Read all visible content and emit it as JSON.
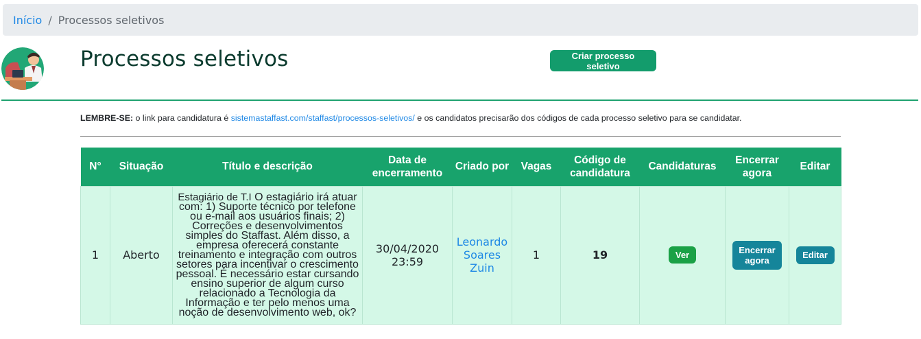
{
  "breadcrumb": {
    "home": "Início",
    "separator": "/",
    "current": "Processos seletivos"
  },
  "header": {
    "title": "Processos seletivos",
    "create_button": "Criar processo seletivo"
  },
  "reminder": {
    "label": "LEMBRE-SE:",
    "text_before": " o link para candidatura é ",
    "link": "sistemastaffast.com/staffast/processos-seletivos/",
    "text_after": " e os candidatos precisarão dos códigos de cada processo seletivo para se candidatar."
  },
  "table": {
    "headers": {
      "num": "N°",
      "status": "Situação",
      "title_desc": "Título e descrição",
      "end_date": "Data de encerramento",
      "created_by": "Criado por",
      "vacancies": "Vagas",
      "code": "Código de candidatura",
      "applications": "Candidaturas",
      "close_now": "Encerrar agora",
      "edit": "Editar"
    },
    "rows": [
      {
        "num": "1",
        "status": "Aberto",
        "title": "Estagiário de T.I",
        "description": " O estagiário irá atuar com: 1) Suporte técnico por telefone ou e-mail aos usuários finais; 2) Correções e desenvolvimentos simples do Staffast. Além disso, a empresa oferecerá constante treinamento e integração com outros setores para incentivar o crescimento pessoal. É necessário estar cursando ensino superior de algum curso relacionado a Tecnologia da Informação e ter pelo menos uma noção de desenvolvimento web, ok?",
        "end_date": "30/04/2020",
        "end_time": "23:59",
        "created_by": "Leonardo Soares Zuin",
        "vacancies": "1",
        "code": "19",
        "view_button": "Ver",
        "close_button": "Encerrar agora",
        "edit_button": "Editar"
      }
    ]
  },
  "colors": {
    "primary_green": "#18a36c",
    "row_bg": "#d4f8e7",
    "teal_button": "#15859a",
    "link_blue": "#1e88e5"
  },
  "icons": {
    "avatar": "person-at-desk-avatar"
  }
}
